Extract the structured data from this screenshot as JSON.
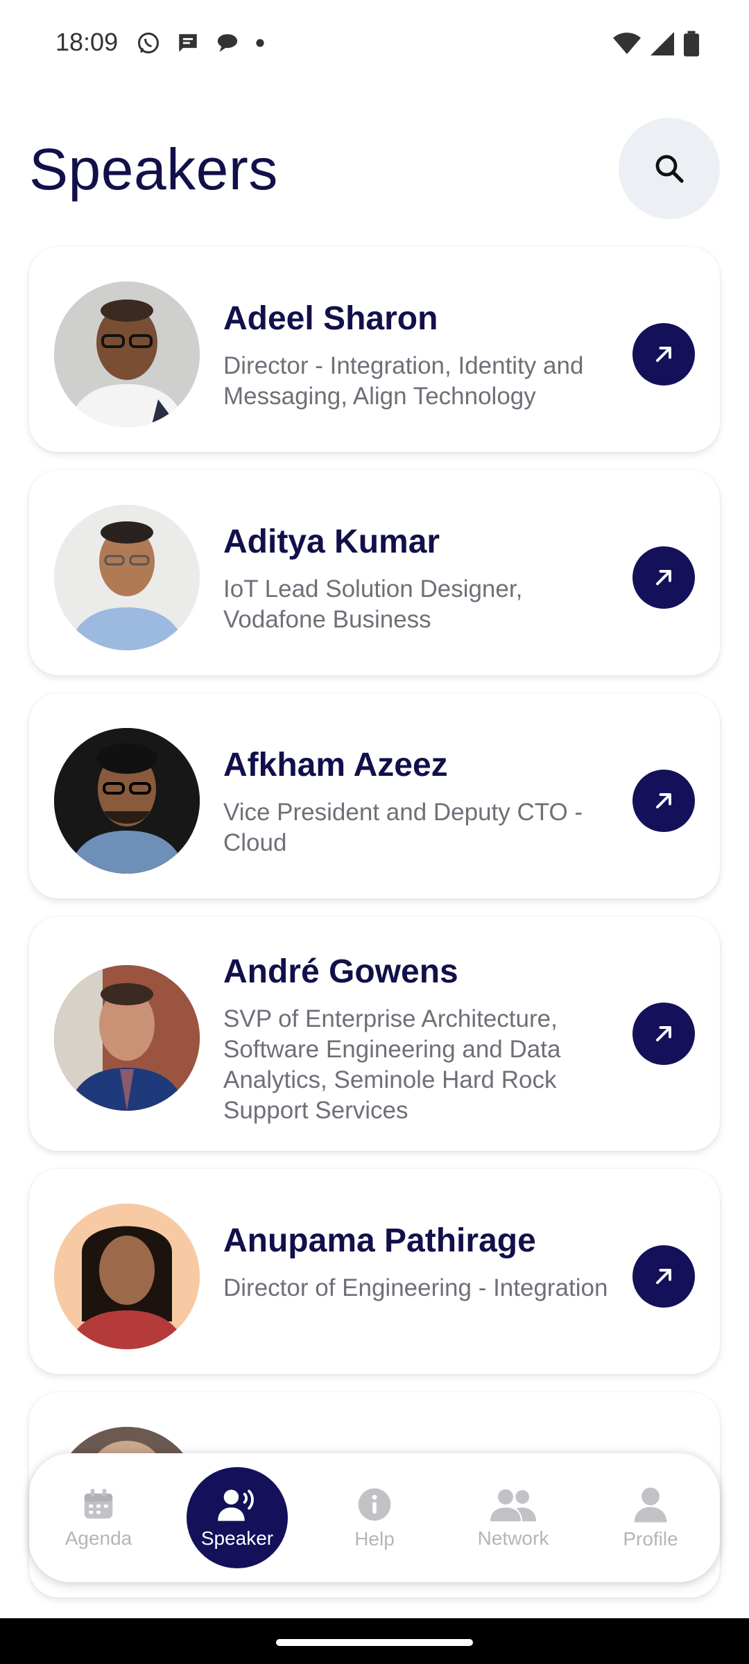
{
  "status_bar": {
    "time": "18:09"
  },
  "header": {
    "title": "Speakers"
  },
  "speakers": [
    {
      "name": "Adeel Sharon",
      "role": "Director - Integration, Identity and Messaging, Align Technology"
    },
    {
      "name": "Aditya Kumar",
      "role": "IoT Lead Solution Designer, Vodafone Business"
    },
    {
      "name": "Afkham Azeez",
      "role": "Vice President and Deputy CTO - Cloud"
    },
    {
      "name": "André Gowens",
      "role": "SVP of Enterprise Architecture, Software Engineering and Data Analytics, Seminole Hard Rock Support Services"
    },
    {
      "name": "Anupama Pathirage",
      "role": "Director of Engineering - Integration"
    }
  ],
  "bottom_nav": {
    "items": [
      {
        "label": "Agenda",
        "icon": "calendar-icon"
      },
      {
        "label": "Speaker",
        "icon": "speaker-icon"
      },
      {
        "label": "Help",
        "icon": "info-icon"
      },
      {
        "label": "Network",
        "icon": "people-icon"
      },
      {
        "label": "Profile",
        "icon": "person-icon"
      }
    ],
    "active": "Speaker"
  },
  "colors": {
    "primary": "#14105a",
    "title": "#12104a",
    "muted": "#6f6f78",
    "inactive_nav": "#b5b5b9",
    "search_bg": "#eceff3"
  }
}
